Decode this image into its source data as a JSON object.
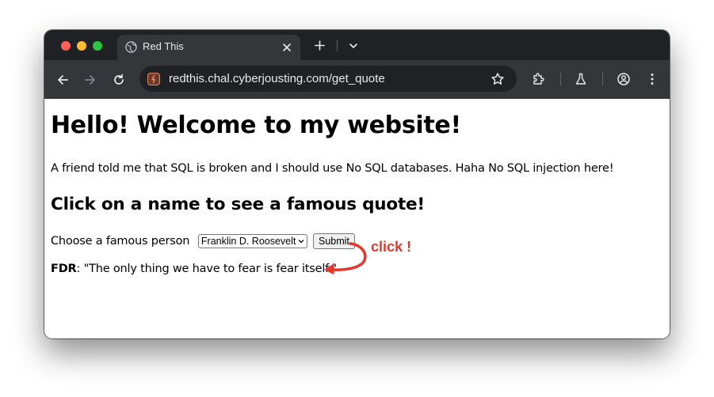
{
  "browser": {
    "tab_title": "Red This",
    "url": "redthis.chal.cyberjousting.com/get_quote"
  },
  "page": {
    "heading": "Hello! Welcome to my website!",
    "intro": "A friend told me that SQL is broken and I should use No SQL databases. Haha No SQL injection here!",
    "subheading": "Click on a name to see a famous quote!",
    "choose_label": "Choose a famous person",
    "selected_person": "Franklin D. Roosevelt",
    "submit_label": "Submit",
    "quote_speaker": "FDR",
    "quote_separator": ": ",
    "quote_text": "\"The only thing we have to fear is fear itself.\""
  },
  "annotation": {
    "text": "click !",
    "color": "#e8362d"
  },
  "colors": {
    "tabbar": "#202124",
    "toolbar": "#35363a",
    "traffic_red": "#ff5f57",
    "traffic_yellow": "#febc2e",
    "traffic_green": "#28c840"
  }
}
